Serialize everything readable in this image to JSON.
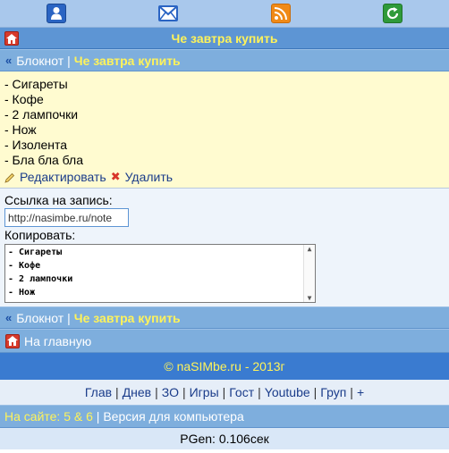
{
  "header": {
    "icons": [
      "user-icon",
      "mail-icon",
      "rss-icon",
      "refresh-icon"
    ],
    "title": "Че завтра купить"
  },
  "breadcrumb": {
    "root": "Блокнот",
    "separator": "|",
    "current": "Че завтра купить"
  },
  "note": {
    "lines": [
      "- Сигареты",
      "- Кофе",
      "- 2 лампочки",
      "- Нож",
      "- Изолента",
      "- Бла бла бла"
    ],
    "edit_label": "Редактировать",
    "delete_label": "Удалить"
  },
  "link": {
    "label": "Ссылка на запись:",
    "value": "http://nasimbe.ru/note"
  },
  "copy": {
    "label": "Копировать:",
    "lines": [
      "- Сигареты",
      "- Кофе",
      "- 2 лампочки",
      "- Нож"
    ]
  },
  "home": {
    "label": "На главную"
  },
  "footer": {
    "copyright": "© naSIMbe.ru - 2013г",
    "nav": [
      "Глав",
      "Днев",
      "ЗО",
      "Игры",
      "Гост",
      "Youtube",
      "Груп",
      "+"
    ],
    "online_label": "На сайте:",
    "online_count": "5 & 6",
    "desktop_label": "Версия для компьютера",
    "pgen": "PGen: 0.106сек"
  },
  "colors": {
    "accent_yellow": "#fff35a",
    "header_blue": "#5d95d4",
    "bar_blue": "#7eaedd",
    "note_bg": "#fffbd0"
  }
}
